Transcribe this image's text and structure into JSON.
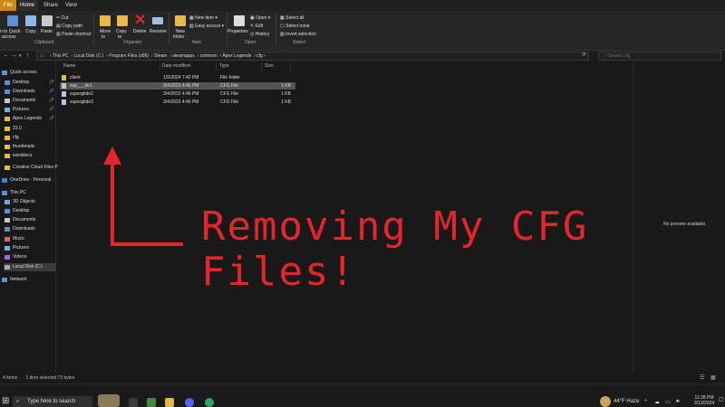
{
  "ribbon": {
    "tabs": [
      "File",
      "Home",
      "Share",
      "View"
    ],
    "buttons": {
      "pin": "n to Quick",
      "pin2": "access",
      "copy": "Copy",
      "paste": "Paste",
      "cut": "Cut",
      "copy_path": "Copy path",
      "paste_shortcut": "Paste shortcut",
      "move_to": "Move",
      "move_to2": "to",
      "copy_to": "Copy",
      "copy_to2": "to",
      "delete": "Delete",
      "rename": "Rename",
      "new_folder": "New",
      "new_folder2": "folder",
      "new_item": "New item",
      "easy_access": "Easy access",
      "properties": "Properties",
      "open": "Open",
      "edit": "Edit",
      "history": "History",
      "select_all": "Select all",
      "select_none": "Select none",
      "invert_selection": "Invert selection"
    },
    "groups": [
      "Clipboard",
      "Organize",
      "New",
      "Open",
      "Select"
    ]
  },
  "address": {
    "path": [
      "This PC",
      "Local Disk (C:)",
      "Program Files (x86)",
      "Steam",
      "steamapps",
      "common",
      "Apex Legends",
      "cfg"
    ],
    "search_placeholder": "Search cfg"
  },
  "nav": [
    {
      "label": "Quick access",
      "icon": "star-icon"
    },
    {
      "label": "Desktop",
      "icon": "desktop-icon",
      "pin": true
    },
    {
      "label": "Downloads",
      "icon": "download-icon",
      "pin": true
    },
    {
      "label": "Documents",
      "icon": "document-icon",
      "pin": true
    },
    {
      "label": "Pictures",
      "icon": "picture-icon",
      "pin": true
    },
    {
      "label": "Apex Legends",
      "icon": "folder-icon",
      "pin": true
    },
    {
      "label": "23.0",
      "icon": "folder-icon"
    },
    {
      "label": "cfg",
      "icon": "folder-icon"
    },
    {
      "label": "thumbnails",
      "icon": "folder-icon"
    },
    {
      "label": "worddocs",
      "icon": "folder-icon"
    },
    {
      "label": "Creative Cloud Files P",
      "icon": "folder-icon"
    },
    {
      "label": "OneDrive - Personal",
      "icon": "cloud-icon"
    },
    {
      "label": "This PC",
      "icon": "pc-icon"
    },
    {
      "label": "3D Objects",
      "icon": "cube-icon"
    },
    {
      "label": "Desktop",
      "icon": "desktop-icon"
    },
    {
      "label": "Documents",
      "icon": "document-icon"
    },
    {
      "label": "Downloads",
      "icon": "download-icon"
    },
    {
      "label": "Music",
      "icon": "music-icon"
    },
    {
      "label": "Pictures",
      "icon": "picture-icon"
    },
    {
      "label": "Videos",
      "icon": "video-icon"
    },
    {
      "label": "Local Disk (C:)",
      "icon": "drive-icon"
    },
    {
      "label": "Network",
      "icon": "network-icon"
    }
  ],
  "columns": [
    "Name",
    "Date modified",
    "Type",
    "Size"
  ],
  "files": [
    {
      "name": "client",
      "date": "1/9/2024 7:42 PM",
      "type": "File folder",
      "size": "",
      "kind": "folder"
    },
    {
      "name": "sup___de1",
      "date": "3/4/2023 4:46 PM",
      "type": "CFG File",
      "size": "1 KB",
      "kind": "file",
      "selected": true
    },
    {
      "name": "superglide2",
      "date": "3/4/2023 4:46 PM",
      "type": "CFG File",
      "size": "1 KB",
      "kind": "file"
    },
    {
      "name": "superglide3",
      "date": "3/4/2023 4:46 PM",
      "type": "CFG File",
      "size": "1 KB",
      "kind": "file"
    }
  ],
  "preview_text": "No preview available.",
  "overlay": {
    "line1": "Removing My CFG",
    "line2": "Files!"
  },
  "status": {
    "items": "4 items",
    "selected": "1 item selected  73 bytes"
  },
  "taskbar": {
    "search_placeholder": "Type here to search",
    "weather": "44°F  Haze",
    "time": "11:28 PM",
    "date": "3/13/2024"
  },
  "colors": {
    "accent_file_tab": "#d08a13",
    "overlay_red": "#e3262b",
    "folder_yellow": "#e8b84a"
  }
}
